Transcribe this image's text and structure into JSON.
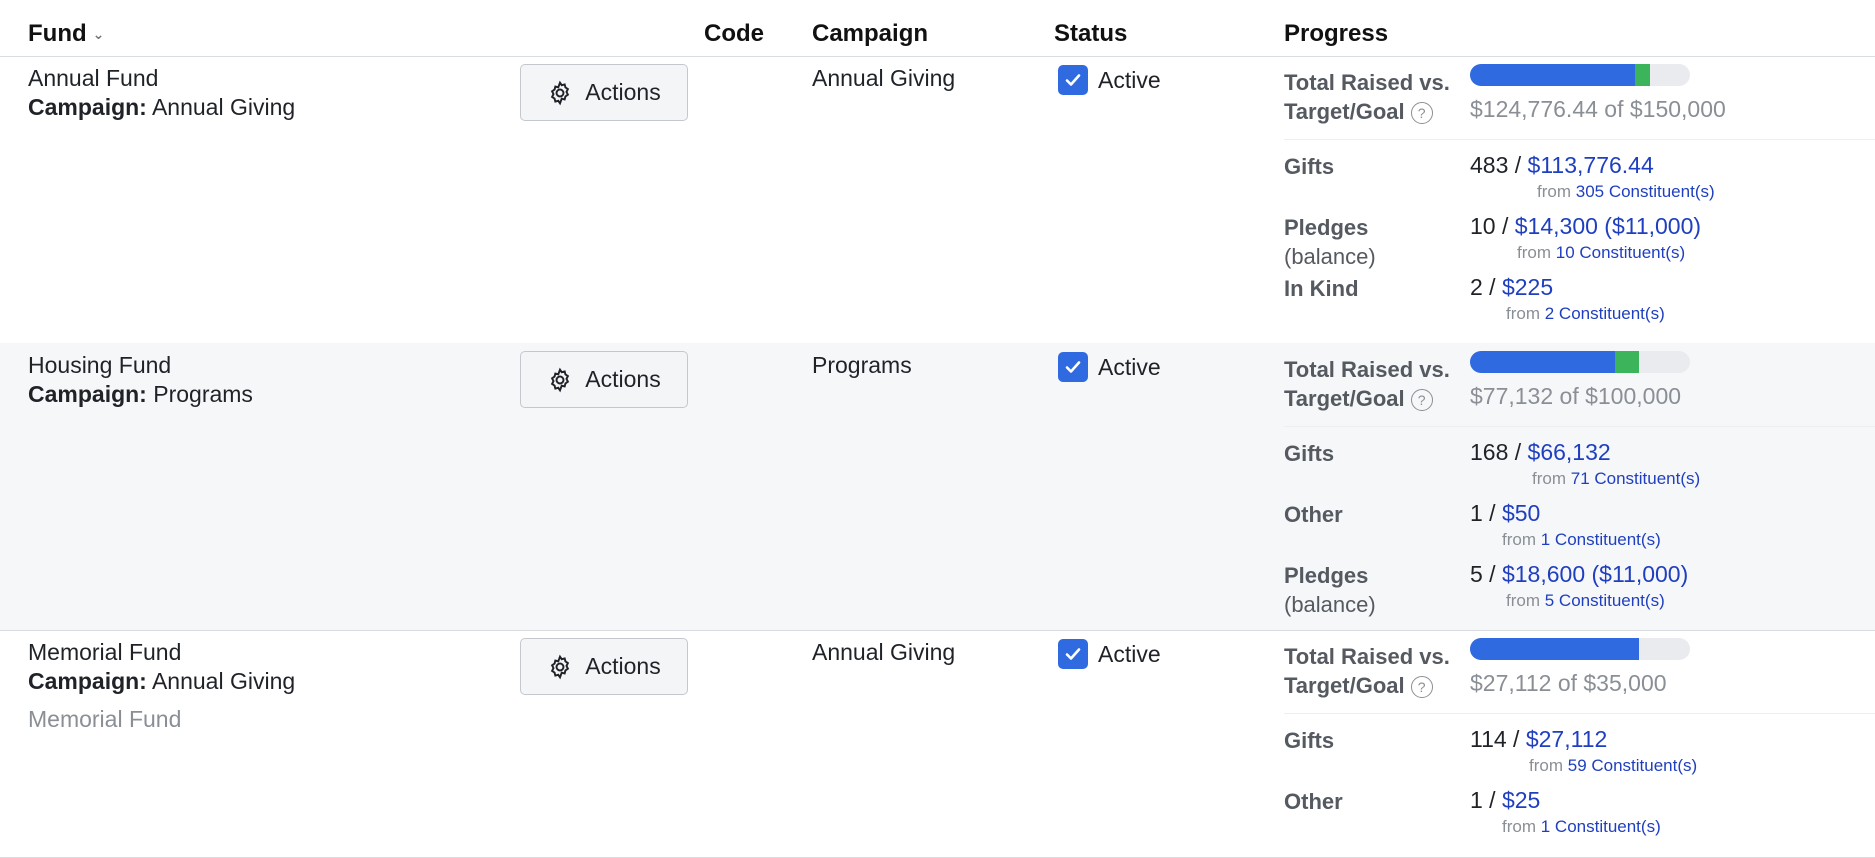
{
  "header": {
    "fund": "Fund",
    "code": "Code",
    "campaign": "Campaign",
    "status": "Status",
    "progress": "Progress",
    "sort_icon": "chevron-down-icon"
  },
  "labels": {
    "campaign_prefix": "Campaign:",
    "actions": "Actions",
    "total_raised_line1": "Total Raised vs.",
    "total_raised_line2": "Target/Goal",
    "help": "?",
    "balance": "(balance)"
  },
  "colors": {
    "bar_blue": "#2f6ae0",
    "bar_green": "#3cb45c",
    "link": "#1f3fbf",
    "checkbox": "#2f6ae0"
  },
  "funds": [
    {
      "name": "Annual Fund",
      "campaign": "Annual Giving",
      "campaign_col": "Annual Giving",
      "status": "Active",
      "progress_blue": 0.75,
      "progress_green": 0.07,
      "total_text": "$124,776.44 of $150,000",
      "items": [
        {
          "label": "Gifts",
          "count": "483 /",
          "amount": "$113,776.44",
          "from": "from",
          "constituents": "305 Constituent(s)"
        },
        {
          "label": "Pledges",
          "count": "10 /",
          "amount": "$14,300 ($11,000)",
          "from": "from",
          "constituents": "10 Constituent(s)"
        },
        {
          "label": "In Kind",
          "count": "2 /",
          "amount": "$225",
          "from": "from",
          "constituents": "2 Constituent(s)"
        }
      ]
    },
    {
      "name": "Housing Fund",
      "campaign": "Programs",
      "campaign_col": "Programs",
      "status": "Active",
      "progress_blue": 0.66,
      "progress_green": 0.11,
      "total_text": "$77,132 of $100,000",
      "items": [
        {
          "label": "Gifts",
          "count": "168 /",
          "amount": "$66,132",
          "from": "from",
          "constituents": "71 Constituent(s)"
        },
        {
          "label": "Other",
          "count": "1 /",
          "amount": "$50",
          "from": "from",
          "constituents": "1 Constituent(s)"
        },
        {
          "label": "Pledges",
          "count": "5 /",
          "amount": "$18,600 ($11,000)",
          "from": "from",
          "constituents": "5 Constituent(s)"
        }
      ]
    },
    {
      "name": "Memorial Fund",
      "campaign": "Annual Giving",
      "campaign_col": "Annual Giving",
      "description": "Memorial Fund",
      "status": "Active",
      "progress_blue": 0.77,
      "progress_green": 0,
      "total_text": "$27,112 of $35,000",
      "items": [
        {
          "label": "Gifts",
          "count": "114 /",
          "amount": "$27,112",
          "from": "from",
          "constituents": "59 Constituent(s)"
        },
        {
          "label": "Other",
          "count": "1 /",
          "amount": "$25",
          "from": "from",
          "constituents": "1 Constituent(s)"
        }
      ]
    }
  ]
}
